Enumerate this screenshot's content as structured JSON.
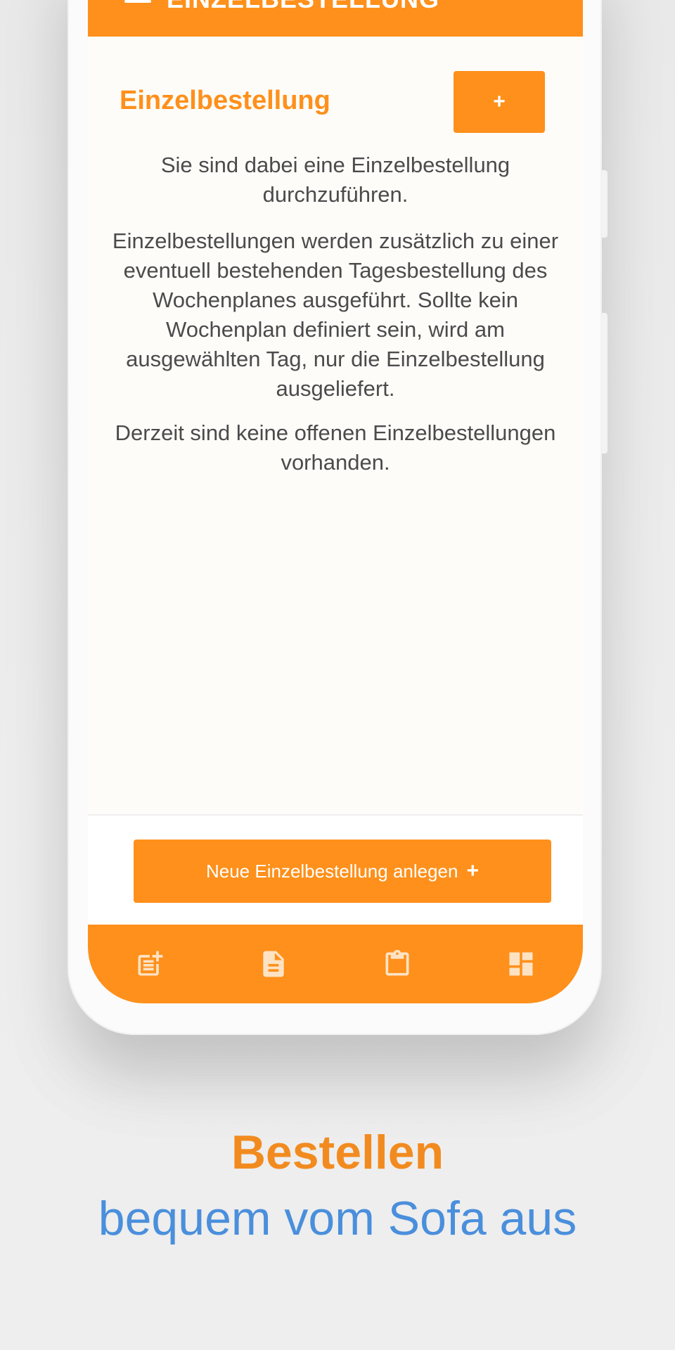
{
  "app": {
    "header_title": "EINZELBESTELLUNG",
    "page_title": "Einzelbestellung",
    "add_button_label": "+",
    "intro_text": "Sie sind dabei eine Einzelbestellung durchzuführen.",
    "info_text": "Einzelbestellungen werden zusätzlich zu einer eventuell bestehenden Tagesbestellung des Wochenplanes ausgeführt. Sollte kein Wochenplan definiert sein, wird am ausgewählten Tag, nur die Einzelbestellung ausgeliefert.",
    "empty_text": "Derzeit sind keine offenen Einzelbestellungen vorhanden.",
    "new_order_button": "Neue Einzelbestellung anlegen",
    "new_order_plus": "+",
    "bottom_nav": [
      {
        "icon": "post-add-icon"
      },
      {
        "icon": "document-icon"
      },
      {
        "icon": "clipboard-icon"
      },
      {
        "icon": "dashboard-icon"
      }
    ]
  },
  "promo": {
    "headline": "Bestellen",
    "subline": "bequem vom Sofa aus"
  },
  "colors": {
    "accent": "#fe901b",
    "headline": "#f28b1f",
    "subline": "#4a8fdc",
    "screen_bg": "#fdfcf9"
  }
}
